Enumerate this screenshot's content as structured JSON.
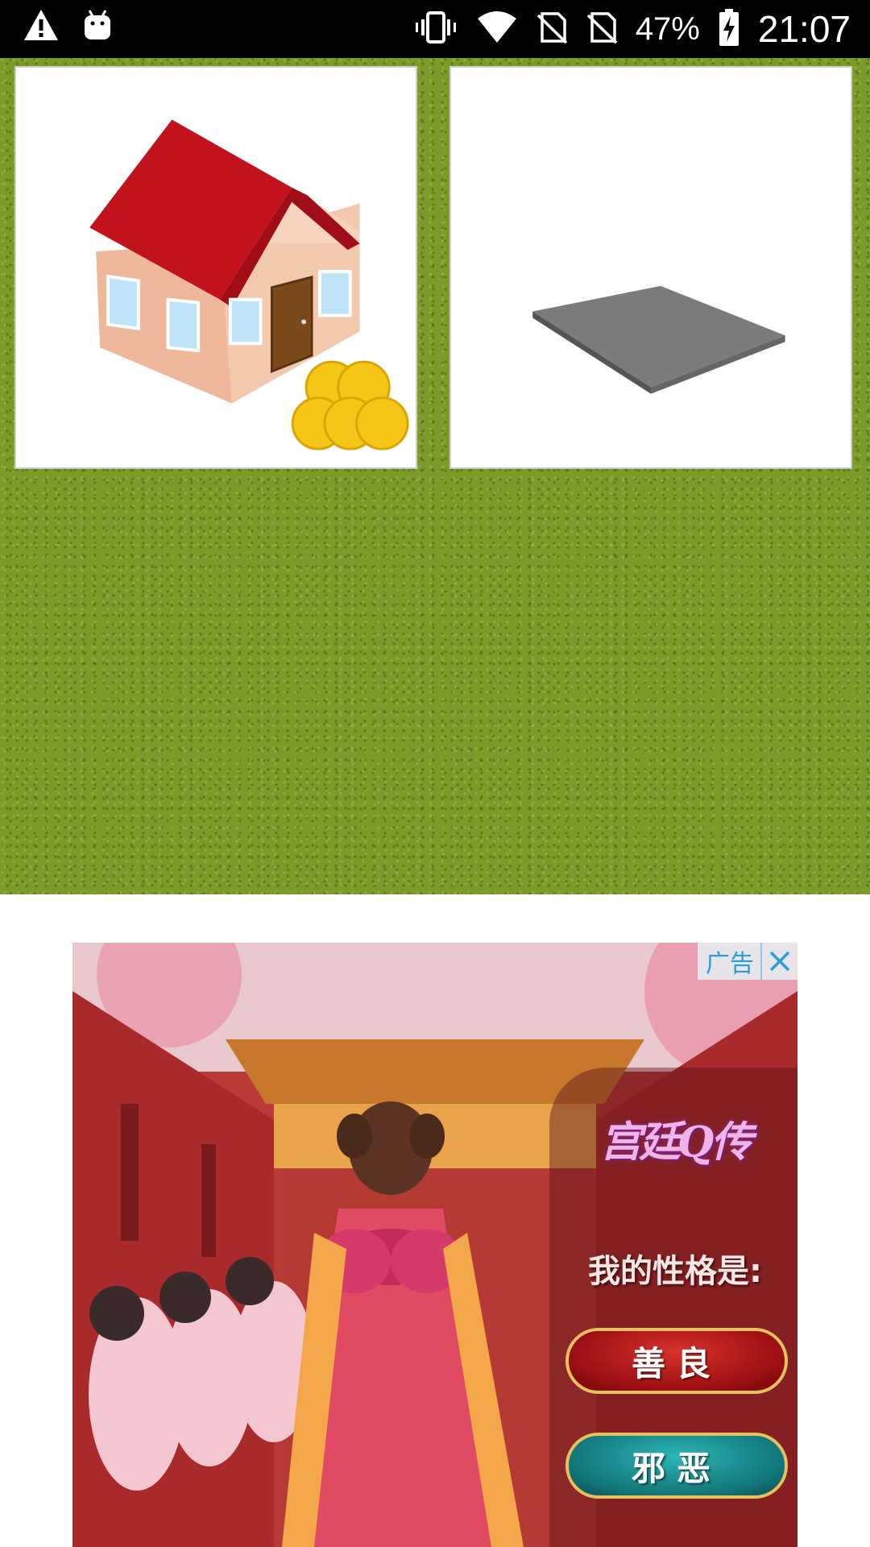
{
  "status_bar": {
    "icons_left": [
      "warning-icon",
      "android-icon"
    ],
    "icons_right": [
      "vibrate-icon",
      "wifi-icon",
      "no-sim-icon",
      "no-sim-icon",
      "battery-charging-icon"
    ],
    "battery": "47%",
    "time": "21:07"
  },
  "game": {
    "tiles": [
      {
        "name": "house-with-coins",
        "icon": "house-icon"
      },
      {
        "name": "empty-plot",
        "icon": "plot-icon"
      }
    ],
    "colors": {
      "grass": "#7a9a2a",
      "tile_bg": "#ffffff",
      "roof": "#c2121c",
      "coin": "#f5c518"
    }
  },
  "ad": {
    "label": "广告",
    "close_icon": "close-icon",
    "logo_text": "宫廷Q传",
    "question": "我的性格是:",
    "button_good": "善良",
    "button_evil": "邪恶"
  }
}
